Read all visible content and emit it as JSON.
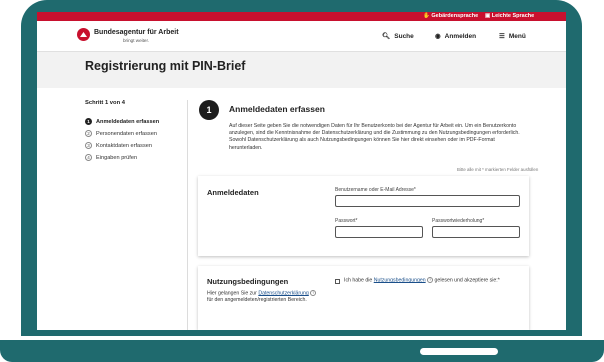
{
  "topbar": {
    "sign_language": "Gebärdensprache",
    "easy_language": "Leichte Sprache"
  },
  "header": {
    "brand": "Bundesagentur für Arbeit",
    "brand_sub": "bringt weiter.",
    "search": "Suche",
    "login": "Anmelden",
    "menu": "Menü"
  },
  "page": {
    "title": "Registrierung mit PIN-Brief"
  },
  "steps": {
    "of_label": "Schritt 1 von 4",
    "items": [
      {
        "num": "1",
        "label": "Anmeldedaten erfassen",
        "active": true
      },
      {
        "num": "2",
        "label": "Personendaten erfassen",
        "active": false
      },
      {
        "num": "3",
        "label": "Kontaktdaten erfassen",
        "active": false
      },
      {
        "num": "4",
        "label": "Eingaben prüfen",
        "active": false
      }
    ]
  },
  "section": {
    "number": "1",
    "title": "Anmeldedaten erfassen",
    "intro": "Auf dieser Seite geben Sie die notwendigen Daten für Ihr Benutzerkonto bei der Agentur für Arbeit ein. Um ein Benutzerkonto anzulegen, sind die Kenntnisnahme der Datenschutzerklärung und die Zustimmung zu den Nutzungsbedingungen erforderlich. Sowohl Datenschutzerklärung als auch Nutzungsbedingungen können Sie hier direkt einsehen oder im PDF-Format herunterladen.",
    "required_hint": "Bitte alle mit * markierten Felder ausfüllen"
  },
  "login_card": {
    "title": "Anmeldedaten",
    "username_label": "Benutzername oder E-Mail Adresse*",
    "username_value": "",
    "password_label": "Passwort*",
    "password_value": "",
    "password_repeat_label": "Passwortwiederholung*",
    "password_repeat_value": ""
  },
  "terms_card": {
    "title": "Nutzungsbedingungen",
    "text_prefix": "Hier gelangen Sie zur",
    "privacy_link": "Datenschutzerklärung",
    "text_suffix": "für den angemeldeten/registrierten Bereich.",
    "checkbox_prefix": "Ich habe die",
    "terms_link": "Nutzungsbedingungen",
    "checkbox_suffix": "gelesen und akzeptiere sie:*"
  },
  "colors": {
    "frame": "#1f6a6e",
    "brand_red": "#c8102e",
    "link": "#1a4f8a"
  }
}
